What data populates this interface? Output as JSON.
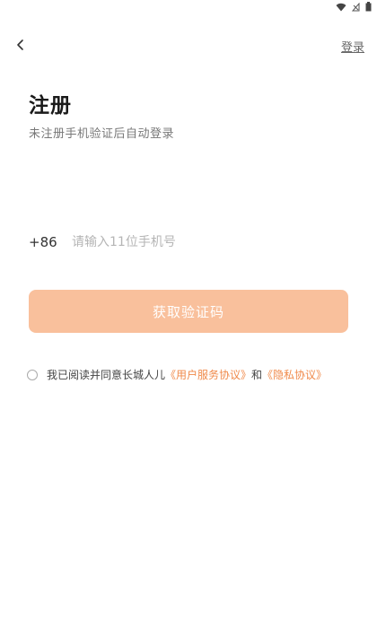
{
  "nav": {
    "login_link": "登录"
  },
  "header": {
    "title": "注册",
    "subtitle": "未注册手机验证后自动登录"
  },
  "phone": {
    "country_code": "+86",
    "placeholder": "请输入11位手机号",
    "value": ""
  },
  "actions": {
    "get_code_label": "获取验证码"
  },
  "agreement": {
    "checked": false,
    "prefix": "我已阅读并同意长城人儿",
    "user_agreement": "《用户服务协议》",
    "conjunction": "和",
    "privacy_agreement": "《隐私协议》"
  },
  "icons": {
    "back": "chevron-left-icon",
    "wifi": "wifi-icon",
    "signal": "signal-icon",
    "battery": "battery-icon"
  },
  "colors": {
    "accent": "#f08a4b",
    "button_disabled_bg": "#f9c09c",
    "background": "#ffffff"
  }
}
